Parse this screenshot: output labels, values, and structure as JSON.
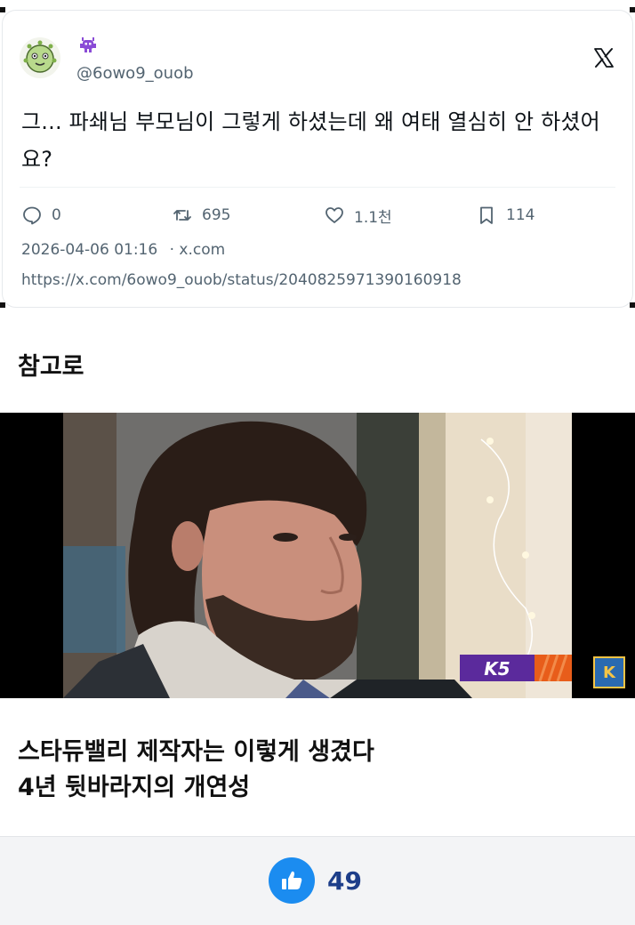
{
  "tweet": {
    "handle": "@6owo9_ouob",
    "text": "그... 파쇄님 부모님이 그렇게 하셨는데 왜 여태 열심히 안 하셨어요?",
    "stats": {
      "replies": "0",
      "retweets": "695",
      "likes": "1.1천",
      "bookmarks": "114"
    },
    "timestamp": "2026-04-06 01:16",
    "source": "· x.com",
    "url": "https://x.com/6owo9_ouob/status/2040825971390160918"
  },
  "section_label": "참고로",
  "video": {
    "channel_badge": "K5",
    "corner_logo": "K"
  },
  "caption": {
    "line1": "스타듀밸리 제작자는 이렇게 생겼다",
    "line2": "4년 뒷바라지의 개연성"
  },
  "footer": {
    "like_count": "49",
    "like_color": "#1b8cf0"
  }
}
